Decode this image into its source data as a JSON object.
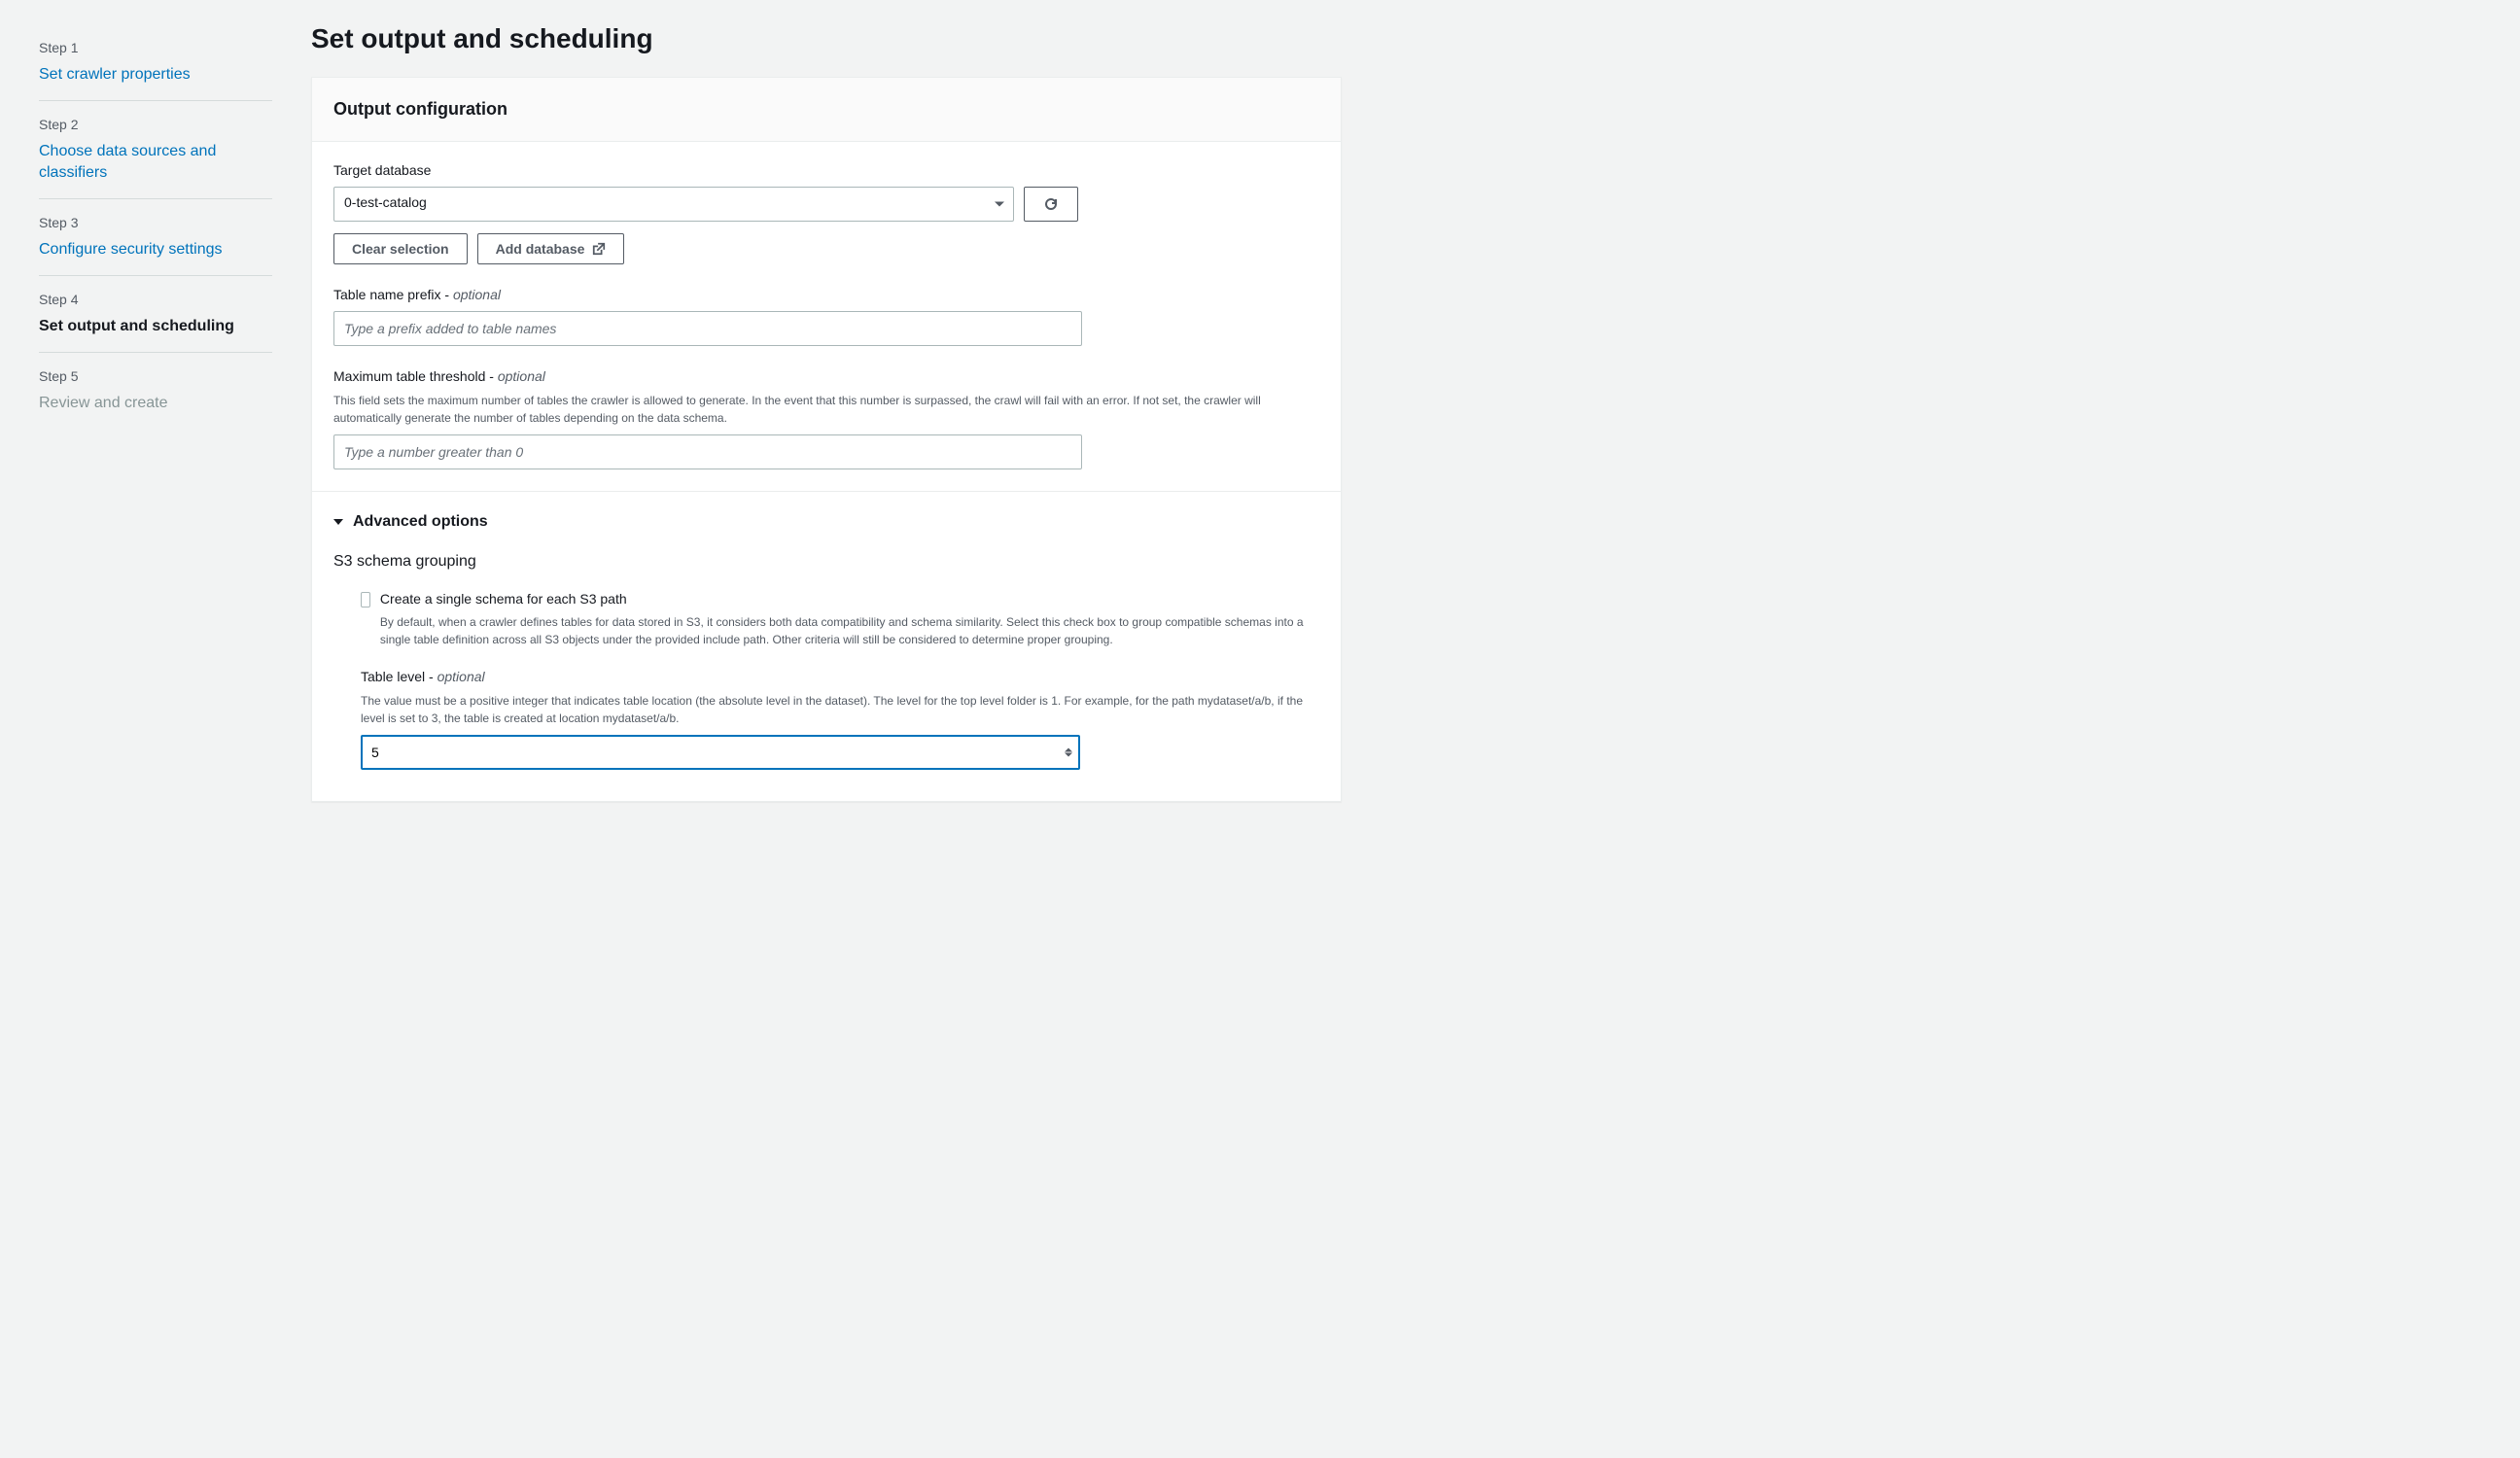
{
  "sidebar": {
    "steps": [
      {
        "number": "Step 1",
        "title": "Set crawler properties"
      },
      {
        "number": "Step 2",
        "title": "Choose data sources and classifiers"
      },
      {
        "number": "Step 3",
        "title": "Configure security settings"
      },
      {
        "number": "Step 4",
        "title": "Set output and scheduling"
      },
      {
        "number": "Step 5",
        "title": "Review and create"
      }
    ]
  },
  "page": {
    "title": "Set output and scheduling"
  },
  "output_config": {
    "heading": "Output configuration",
    "target_database": {
      "label": "Target database",
      "value": "0-test-catalog"
    },
    "clear_button": "Clear selection",
    "add_button": "Add database",
    "table_prefix": {
      "label": "Table name prefix - ",
      "optional": "optional",
      "placeholder": "Type a prefix added to table names",
      "value": ""
    },
    "max_threshold": {
      "label": "Maximum table threshold - ",
      "optional": "optional",
      "description": "This field sets the maximum number of tables the crawler is allowed to generate. In the event that this number is surpassed, the crawl will fail with an error. If not set, the crawler will automatically generate the number of tables depending on the data schema.",
      "placeholder": "Type a number greater than 0",
      "value": ""
    },
    "advanced": {
      "title": "Advanced options",
      "s3_grouping": {
        "title": "S3 schema grouping",
        "checkbox_label": "Create a single schema for each S3 path",
        "checkbox_description": "By default, when a crawler defines tables for data stored in S3, it considers both data compatibility and schema similarity. Select this check box to group compatible schemas into a single table definition across all S3 objects under the provided include path. Other criteria will still be considered to determine proper grouping."
      },
      "table_level": {
        "label": "Table level - ",
        "optional": "optional",
        "description": "The value must be a positive integer that indicates table location (the absolute level in the dataset). The level for the top level folder is 1. For example, for the path mydataset/a/b, if the level is set to 3, the table is created at location mydataset/a/b.",
        "value": "5"
      }
    }
  }
}
